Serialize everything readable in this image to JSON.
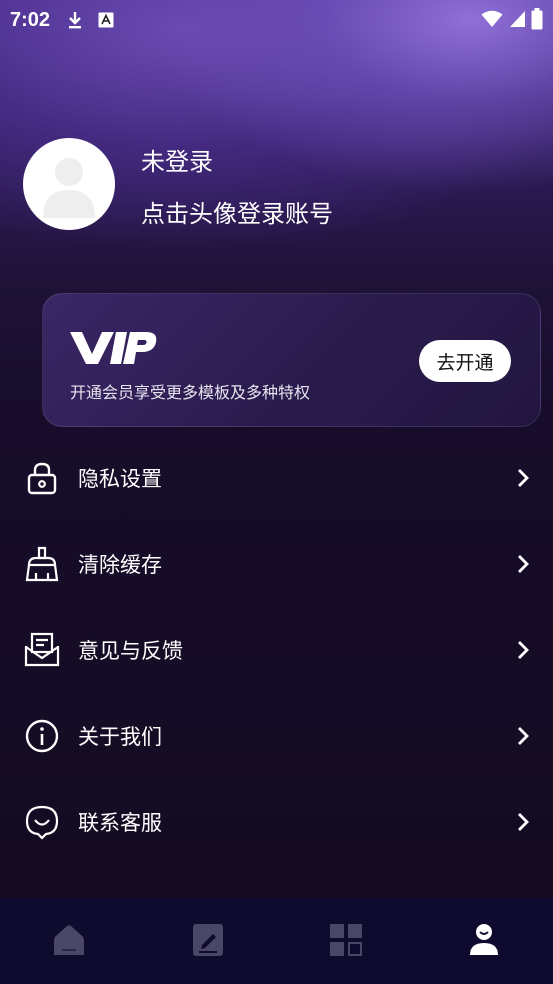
{
  "status_bar": {
    "time": "7:02",
    "icons": [
      "download-icon",
      "text-a-icon",
      "wifi-icon",
      "signal-icon",
      "battery-icon"
    ]
  },
  "profile": {
    "login_status": "未登录",
    "login_hint": "点击头像登录账号",
    "avatar_icon": "default-user-avatar"
  },
  "vip": {
    "logo": "VIP",
    "description": "开通会员享受更多模板及多种特权",
    "button_label": "去开通"
  },
  "menu": {
    "items": [
      {
        "label": "隐私设置",
        "icon": "lock-icon"
      },
      {
        "label": "清除缓存",
        "icon": "broom-icon"
      },
      {
        "label": "意见与反馈",
        "icon": "mail-feedback-icon"
      },
      {
        "label": "关于我们",
        "icon": "info-icon"
      },
      {
        "label": "联系客服",
        "icon": "customer-service-icon"
      }
    ]
  },
  "bottom_nav": {
    "items": [
      {
        "name": "home",
        "icon": "home-icon",
        "active": false
      },
      {
        "name": "edit",
        "icon": "edit-icon",
        "active": false
      },
      {
        "name": "templates",
        "icon": "grid-icon",
        "active": false
      },
      {
        "name": "profile",
        "icon": "user-icon",
        "active": true
      }
    ]
  },
  "colors": {
    "background": "#140b22",
    "header_purple": "#6a4ab0",
    "vip_card": "#2a1b4d",
    "nav_bg": "#0f0b2e",
    "inactive_icon": "#4a4668",
    "active_icon": "#ffffff"
  }
}
